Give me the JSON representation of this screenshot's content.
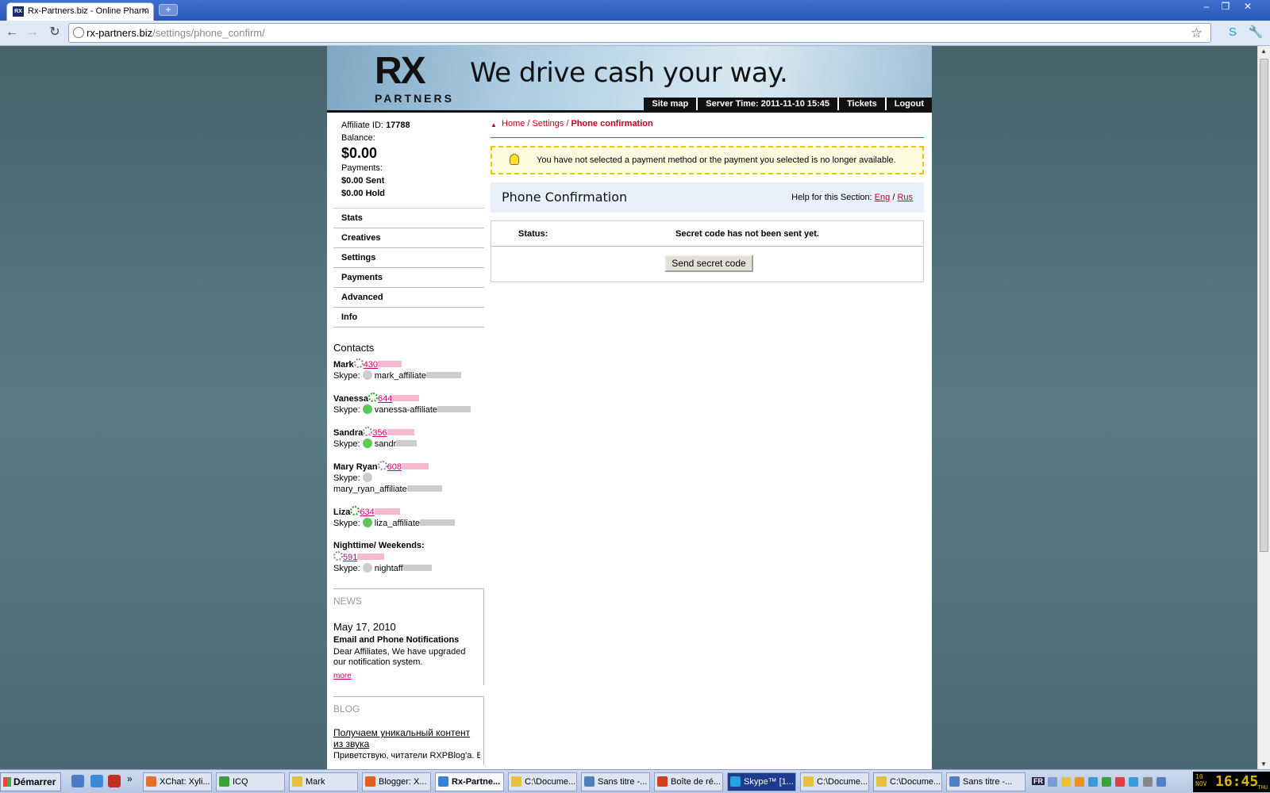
{
  "browser": {
    "tab_title": "Rx-Partners.biz - Online Pharm",
    "tab_favicon": "RX",
    "url_domain": "rx-partners.biz",
    "url_path": "/settings/phone_confirm/"
  },
  "banner": {
    "logo_text": "RX",
    "logo_sub": "PARTNERS",
    "slogan": "We drive cash your way.",
    "nav": {
      "sitemap": "Site map",
      "server_time": "Server Time: 2011-11-10 15:45",
      "tickets": "Tickets",
      "logout": "Logout"
    }
  },
  "sidebar": {
    "affiliate_label": "Affiliate ID:",
    "affiliate_id": "17788",
    "balance_label": "Balance:",
    "balance": "$0.00",
    "payments_label": "Payments:",
    "sent": "$0.00 Sent",
    "hold": "$0.00 Hold",
    "menu": [
      "Stats",
      "Creatives",
      "Settings",
      "Payments",
      "Advanced",
      "Info"
    ],
    "contacts_title": "Contacts",
    "contacts": [
      {
        "name": "Mark",
        "phone": "430",
        "skype": "mark_affiliate"
      },
      {
        "name": "Vanessa",
        "phone": "644",
        "skype": "vanessa-affiliate"
      },
      {
        "name": "Sandra",
        "phone": "356",
        "skype": "sandr"
      },
      {
        "name": "Mary Ryan",
        "phone": "608",
        "skype": "mary_ryan_affiliate"
      },
      {
        "name": "Liza",
        "phone": "634",
        "skype": "liza_affiliate"
      },
      {
        "name": "Nighttime/ Weekends:",
        "phone": "591",
        "skype": "nightaff"
      }
    ],
    "skype_label": "Skype:",
    "news": {
      "title": "NEWS",
      "date": "May 17, 2010",
      "headline": "Email and Phone Notifications",
      "body": "Dear Affiliates, We have upgraded our notification system.",
      "more": "more"
    },
    "blog": {
      "title": "BLOG",
      "headline": "Получаем уникальный контент из звука",
      "body": "Приветствую, читатели RXPBlog'a. В"
    }
  },
  "main": {
    "breadcrumb": {
      "home": "Home",
      "settings": "Settings",
      "current": "Phone confirmation",
      "sep": " / "
    },
    "alert": "You have not selected a payment method or the payment you selected is no longer available.",
    "section_title": "Phone Confirmation",
    "help_label": "Help for this Section:",
    "help_eng": "Eng",
    "help_rus": "Rus",
    "help_sep": " / ",
    "status_label": "Status:",
    "status_value": "Secret code has not been sent yet.",
    "send_button": "Send secret code"
  },
  "taskbar": {
    "start": "Démarrer",
    "tasks": [
      {
        "label": "XChat: Xyli...",
        "color": "#e07030"
      },
      {
        "label": "ICQ",
        "color": "#3aa03a"
      },
      {
        "label": "Mark",
        "color": "#e8c040"
      },
      {
        "label": "Blogger: X...",
        "color": "#e06020"
      },
      {
        "label": "Rx-Partne...",
        "color": "#3a80d0"
      },
      {
        "label": "C:\\Docume...",
        "color": "#e8c040"
      },
      {
        "label": "Sans titre -...",
        "color": "#5080c0"
      },
      {
        "label": "Boîte de ré...",
        "color": "#d04020"
      },
      {
        "label": "Skype™ [1...",
        "color": "#2aa0e0"
      },
      {
        "label": "C:\\Docume...",
        "color": "#e8c040"
      },
      {
        "label": "C:\\Docume...",
        "color": "#e8c040"
      },
      {
        "label": "Sans titre -...",
        "color": "#5080c0"
      }
    ],
    "lang": "FR",
    "clock_day": "10",
    "clock_month": "NOV",
    "clock_time": "16:45",
    "clock_weekday": "THU"
  }
}
